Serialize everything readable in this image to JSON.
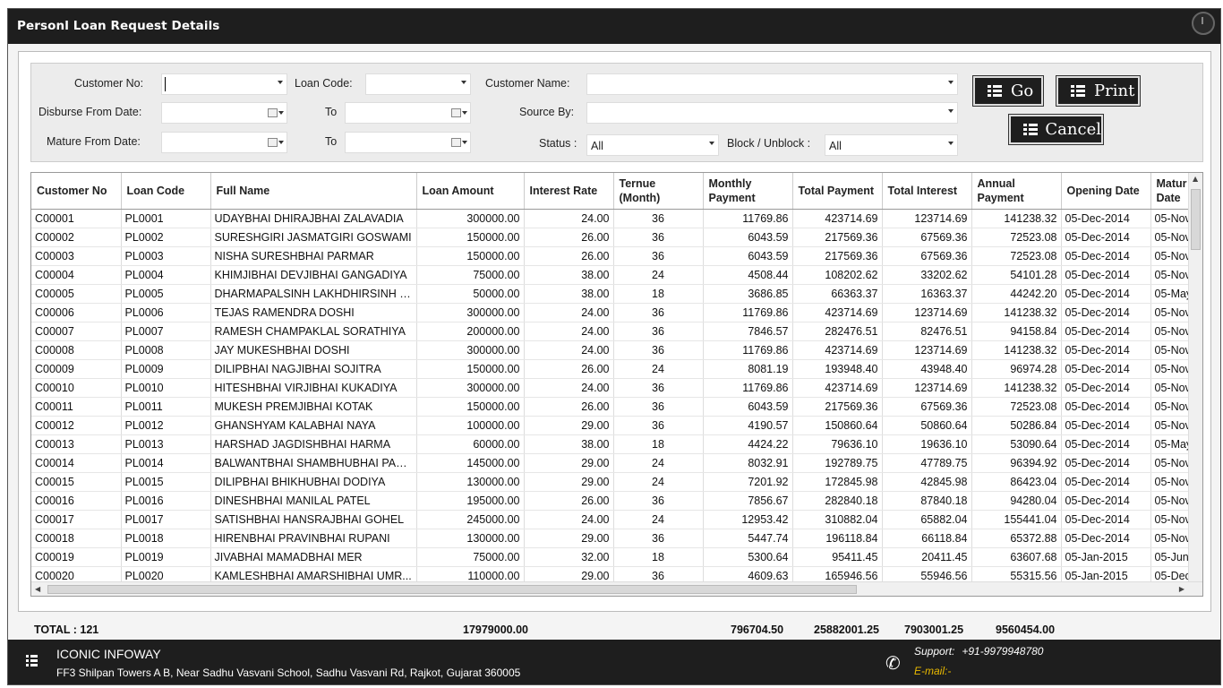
{
  "window": {
    "title": "Personl Loan Request Details"
  },
  "filters": {
    "customer_no_label": "Customer No:",
    "customer_no_value": "",
    "loan_code_label": "Loan Code:",
    "loan_code_value": "",
    "customer_name_label": "Customer Name:",
    "customer_name_value": "",
    "disburse_from_label": "Disburse From Date:",
    "disburse_to_label": "To",
    "source_by_label": "Source By:",
    "source_by_value": "",
    "mature_from_label": "Mature From Date:",
    "mature_to_label": "To",
    "status_label": "Status :",
    "status_value": "All",
    "block_label": "Block / Unblock :",
    "block_value": "All"
  },
  "buttons": {
    "go": "Go",
    "print": "Print",
    "cancel": "Cancel"
  },
  "table": {
    "columns": [
      "Customer No",
      "Loan Code",
      "Full Name",
      "Loan Amount",
      "Interest Rate",
      "Ternue (Month)",
      "Monthly Payment",
      "Total Payment",
      "Total Interest",
      "Annual Payment",
      "Opening Date",
      "Matur Date"
    ],
    "rows": [
      [
        "C00001",
        "PL0001",
        "UDAYBHAI DHIRAJBHAI ZALAVADIA",
        "300000.00",
        "24.00",
        "36",
        "11769.86",
        "423714.69",
        "123714.69",
        "141238.32",
        "05-Dec-2014",
        "05-Nov"
      ],
      [
        "C00002",
        "PL0002",
        "SURESHGIRI JASMATGIRI GOSWAMI",
        "150000.00",
        "26.00",
        "36",
        "6043.59",
        "217569.36",
        "67569.36",
        "72523.08",
        "05-Dec-2014",
        "05-Nov"
      ],
      [
        "C00003",
        "PL0003",
        "NISHA SURESHBHAI PARMAR",
        "150000.00",
        "26.00",
        "36",
        "6043.59",
        "217569.36",
        "67569.36",
        "72523.08",
        "05-Dec-2014",
        "05-Nov"
      ],
      [
        "C00004",
        "PL0004",
        "KHIMJIBHAI DEVJIBHAI  GANGADIYA",
        "75000.00",
        "38.00",
        "24",
        "4508.44",
        "108202.62",
        "33202.62",
        "54101.28",
        "05-Dec-2014",
        "05-Nov"
      ],
      [
        "C00005",
        "PL0005",
        "DHARMAPALSINH LAKHDHIRSINH R...",
        "50000.00",
        "38.00",
        "18",
        "3686.85",
        "66363.37",
        "16363.37",
        "44242.20",
        "05-Dec-2014",
        "05-May"
      ],
      [
        "C00006",
        "PL0006",
        "TEJAS RAMENDRA DOSHI",
        "300000.00",
        "24.00",
        "36",
        "11769.86",
        "423714.69",
        "123714.69",
        "141238.32",
        "05-Dec-2014",
        "05-Nov"
      ],
      [
        "C00007",
        "PL0007",
        "RAMESH CHAMPAKLAL SORATHIYA",
        "200000.00",
        "24.00",
        "36",
        "7846.57",
        "282476.51",
        "82476.51",
        "94158.84",
        "05-Dec-2014",
        "05-Nov"
      ],
      [
        "C00008",
        "PL0008",
        "JAY MUKESHBHAI DOSHI",
        "300000.00",
        "24.00",
        "36",
        "11769.86",
        "423714.69",
        "123714.69",
        "141238.32",
        "05-Dec-2014",
        "05-Nov"
      ],
      [
        "C00009",
        "PL0009",
        "DILIPBHAI NAGJIBHAI SOJITRA",
        "150000.00",
        "26.00",
        "24",
        "8081.19",
        "193948.40",
        "43948.40",
        "96974.28",
        "05-Dec-2014",
        "05-Nov"
      ],
      [
        "C00010",
        "PL0010",
        "HITESHBHAI VIRJIBHAI KUKADIYA",
        "300000.00",
        "24.00",
        "36",
        "11769.86",
        "423714.69",
        "123714.69",
        "141238.32",
        "05-Dec-2014",
        "05-Nov"
      ],
      [
        "C00011",
        "PL0011",
        "MUKESH PREMJIBHAI KOTAK",
        "150000.00",
        "26.00",
        "36",
        "6043.59",
        "217569.36",
        "67569.36",
        "72523.08",
        "05-Dec-2014",
        "05-Nov"
      ],
      [
        "C00012",
        "PL0012",
        "GHANSHYAM  KALABHAI NAYA",
        "100000.00",
        "29.00",
        "36",
        "4190.57",
        "150860.64",
        "50860.64",
        "50286.84",
        "05-Dec-2014",
        "05-Nov"
      ],
      [
        "C00013",
        "PL0013",
        "HARSHAD JAGDISHBHAI HARMA",
        "60000.00",
        "38.00",
        "18",
        "4424.22",
        "79636.10",
        "19636.10",
        "53090.64",
        "05-Dec-2014",
        "05-May"
      ],
      [
        "C00014",
        "PL0014",
        "BALWANTBHAI SHAMBHUBHAI PAN...",
        "145000.00",
        "29.00",
        "24",
        "8032.91",
        "192789.75",
        "47789.75",
        "96394.92",
        "05-Dec-2014",
        "05-Nov"
      ],
      [
        "C00015",
        "PL0015",
        "DILIPBHAI BHIKHUBHAI DODIYA",
        "130000.00",
        "29.00",
        "24",
        "7201.92",
        "172845.98",
        "42845.98",
        "86423.04",
        "05-Dec-2014",
        "05-Nov"
      ],
      [
        "C00016",
        "PL0016",
        "DINESHBHAI MANILAL PATEL",
        "195000.00",
        "26.00",
        "36",
        "7856.67",
        "282840.18",
        "87840.18",
        "94280.04",
        "05-Dec-2014",
        "05-Nov"
      ],
      [
        "C00017",
        "PL0017",
        "SATISHBHAI HANSRAJBHAI GOHEL",
        "245000.00",
        "24.00",
        "24",
        "12953.42",
        "310882.04",
        "65882.04",
        "155441.04",
        "05-Dec-2014",
        "05-Nov"
      ],
      [
        "C00018",
        "PL0018",
        "HIRENBHAI PRAVINBHAI RUPANI",
        "130000.00",
        "29.00",
        "36",
        "5447.74",
        "196118.84",
        "66118.84",
        "65372.88",
        "05-Dec-2014",
        "05-Nov"
      ],
      [
        "C00019",
        "PL0019",
        "JIVABHAI MAMADBHAI MER",
        "75000.00",
        "32.00",
        "18",
        "5300.64",
        "95411.45",
        "20411.45",
        "63607.68",
        "05-Jan-2015",
        "05-Jun-"
      ],
      [
        "C00020",
        "PL0020",
        "KAMLESHBHAI AMARSHIBHAI UMR...",
        "110000.00",
        "29.00",
        "36",
        "4609.63",
        "165946.56",
        "55946.56",
        "55315.56",
        "05-Jan-2015",
        "05-Dec"
      ]
    ]
  },
  "totals": {
    "label": "TOTAL : 121",
    "loan_amount": "17979000.00",
    "monthly_payment": "796704.50",
    "total_payment": "25882001.25",
    "total_interest": "7903001.25",
    "annual_payment": "9560454.00"
  },
  "footer": {
    "company": "ICONIC INFOWAY",
    "address": "FF3 Shilpan Towers A  B, Near Sadhu Vasvani School, Sadhu Vasvani Rd, Rajkot, Gujarat 360005",
    "support_label": "Support:",
    "support_phone": "+91-9979948780",
    "email_label": "E-mail:-"
  }
}
